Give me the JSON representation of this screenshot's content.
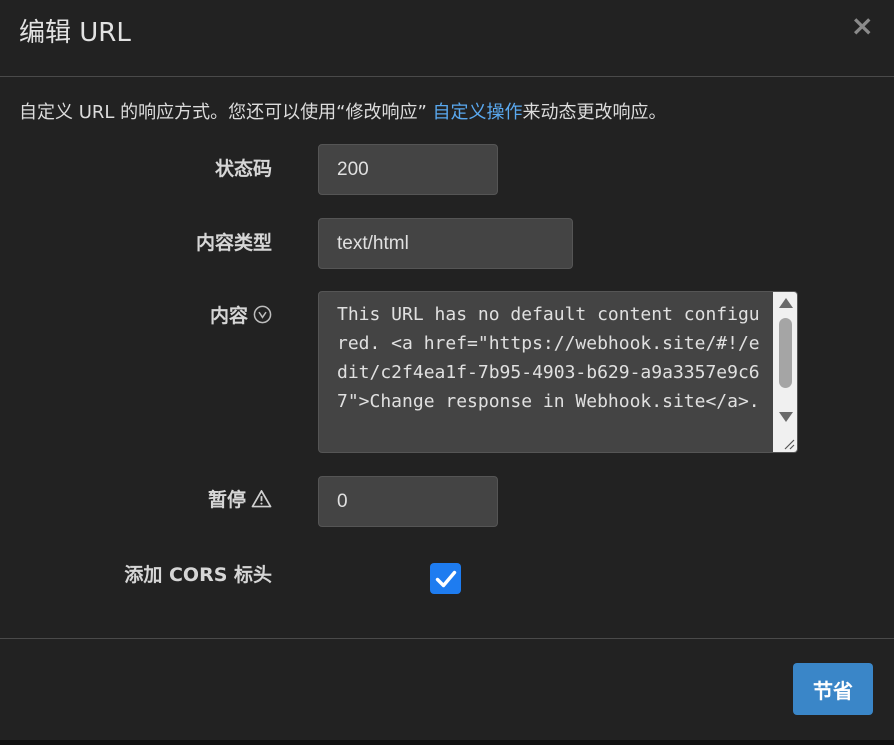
{
  "dialog": {
    "title": "编辑 URL",
    "close_glyph": "×"
  },
  "description": {
    "before": "自定义 URL 的响应方式。您还可以使用“修改响应” ",
    "link": "自定义操作",
    "after": "来动态更改响应。"
  },
  "form": {
    "status_code": {
      "label": "状态码",
      "value": "200"
    },
    "content_type": {
      "label": "内容类型",
      "value": "text/html"
    },
    "content": {
      "label": "内容",
      "icon": "chevron-circle-icon",
      "value": "This URL has no default content configured. <a href=\"https://webhook.site/#!/edit/c2f4ea1f-7b95-4903-b629-a9a3357e9c67\">Change response in Webhook.site</a>."
    },
    "timeout": {
      "label": "暂停",
      "icon": "warning-icon",
      "value": "0"
    },
    "cors": {
      "label": "添加 CORS 标头",
      "checked": true
    }
  },
  "footer": {
    "save_label": "节省"
  },
  "colors": {
    "link": "#5aa9f0",
    "checkbox": "#1e7cf0",
    "save_button": "#3a86c8"
  }
}
